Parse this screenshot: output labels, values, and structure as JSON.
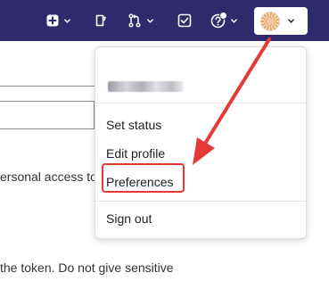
{
  "dropdown": {
    "items": [
      {
        "label": "Set status"
      },
      {
        "label": "Edit profile"
      },
      {
        "label": "Preferences"
      },
      {
        "label": "Sign out"
      }
    ]
  },
  "background": {
    "text1": "ersonal access to",
    "text2": "the token. Do not give sensitive"
  },
  "colors": {
    "topbar": "#2f2a6b",
    "highlight": "#e53935"
  },
  "icons": [
    "plus-square-icon",
    "issue-icon",
    "merge-request-icon",
    "todo-icon",
    "help-icon",
    "chevron-down-icon"
  ]
}
